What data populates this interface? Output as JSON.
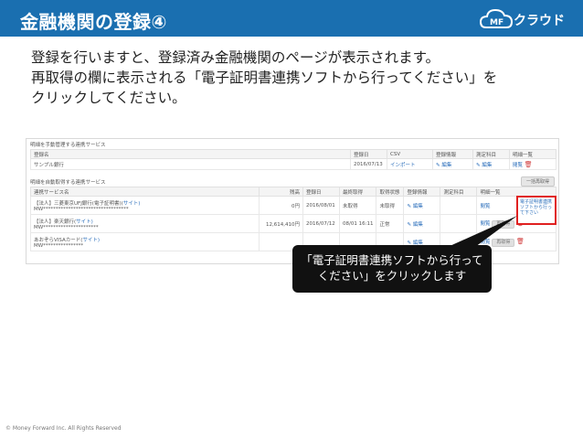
{
  "header": {
    "title": "金融機関の登録④",
    "logo_mf": "MF",
    "logo_text": "クラウド"
  },
  "intro": {
    "line1": "登録を行いますと、登録済み金融機関のページが表示されます。",
    "line2": "再取得の欄に表示される「電子証明書連携ソフトから行ってください」を",
    "line3": "クリックしてください。"
  },
  "manual_section": {
    "title": "明細を手動管理する連携サービス",
    "columns": [
      "登録名",
      "登録日",
      "CSV",
      "登録情報",
      "測定科目",
      "明細一覧"
    ],
    "row": {
      "name": "サンプル銀行",
      "date": "2016/07/13",
      "csv": "インポート",
      "edit": "編集",
      "subject_edit": "編集",
      "view": "閲覧"
    }
  },
  "auto_section": {
    "title": "明細を自動取得する連携サービス",
    "bulk_button": "一括再取得",
    "columns": [
      "連携サービス名",
      "残高",
      "登録日",
      "最終取得",
      "取得状態",
      "登録情報",
      "測定科目",
      "明細一覧"
    ],
    "rows": [
      {
        "name": "【法人】三菱東京UFJ銀行(電子証明書)(",
        "site": "サイト)",
        "id": "MW**********************************",
        "balance": "0円",
        "date": "2016/08/01",
        "last": "未取得",
        "status": "未取得",
        "edit": "編集",
        "view": "閲覧",
        "refetch": "電子証明書連携ソフトから行って下さい"
      },
      {
        "name": "【法人】楽天銀行(",
        "site": "サイト)",
        "id": "MW**********************",
        "balance": "12,614,410円",
        "date": "2016/07/12",
        "last": "08/01 16:11",
        "status": "正常",
        "edit": "編集",
        "view": "閲覧",
        "refetch": "再取得"
      },
      {
        "name": "あおぞらVISAカード(",
        "site": "サイト)",
        "id": "MW****************",
        "balance": "",
        "date": "",
        "last": "",
        "status": "",
        "edit": "編集",
        "view": "閲覧",
        "refetch": "再取得"
      }
    ]
  },
  "callout": {
    "line1": "「電子証明書連携ソフトから行って",
    "line2": "ください」をクリックします"
  },
  "footer": "© Money Forward Inc. All Rights Reserved"
}
